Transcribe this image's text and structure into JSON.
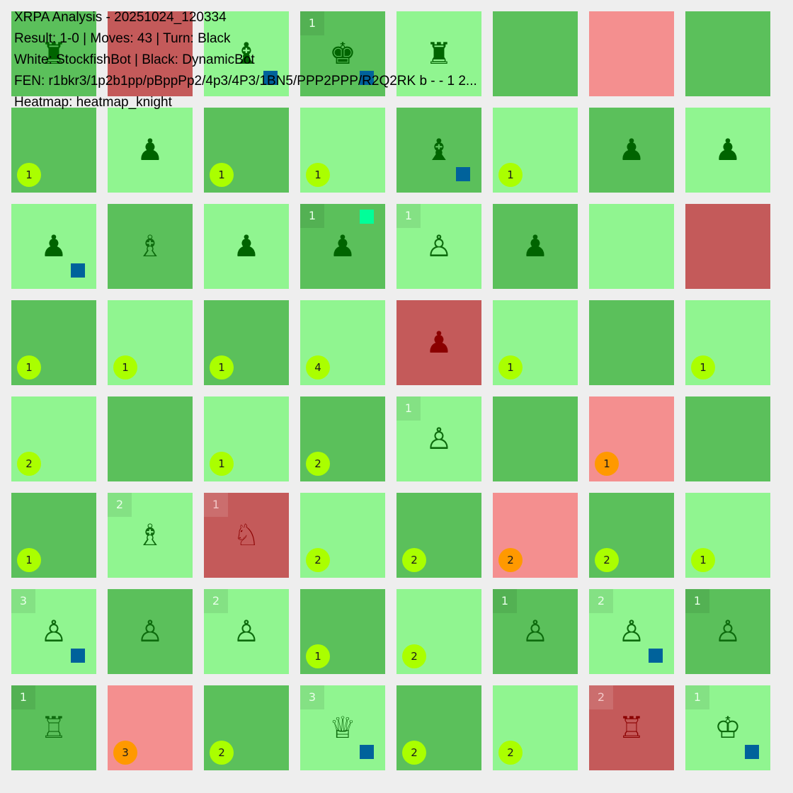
{
  "info": {
    "title": "XRPA Analysis - 20251024_120334",
    "result_line": "Result: 1-0 | Moves: 43 | Turn: Black",
    "players_line": "White: StockfishBot | Black: DynamicBot",
    "fen_line": "FEN: r1bkr3/1p2b1pp/pBppPp2/4p3/4P3/1BN5/PPP2PPP/R2Q2RK b - - 1 2...",
    "heatmap_line": "Heatmap: heatmap_knight"
  },
  "colors": {
    "light": "#90f590",
    "dark": "#5bc05b",
    "pink": "#f48f8f",
    "red": "#c45a5a",
    "white_piece": "#0d6b0d",
    "black_piece": "#006400",
    "knight_piece": "#8b0000",
    "red_piece": "#8b0000",
    "bubble_green": "#aaff00",
    "bubble_orange": "#ff9900",
    "mark_blue": "#00629b",
    "mark_cyan": "#00ff99"
  },
  "board": [
    [
      {
        "bg": "dark",
        "piece": "♜",
        "pc": "black"
      },
      {
        "bg": "red"
      },
      {
        "bg": "light",
        "piece": "♝",
        "pc": "black"
      },
      {
        "bg": "dark",
        "piece": "♚",
        "pc": "black",
        "corner": "1",
        "mark": "blue",
        "mark_pos": "tl"
      },
      {
        "bg": "light",
        "piece": "♜",
        "pc": "black",
        "mark": "blue",
        "mark_pos": "tl"
      },
      {
        "bg": "dark"
      },
      {
        "bg": "pink"
      },
      {
        "bg": "dark"
      }
    ],
    [
      {
        "bg": "dark",
        "bubble": "1",
        "bc": "green"
      },
      {
        "bg": "light",
        "piece": "♟",
        "pc": "black"
      },
      {
        "bg": "dark",
        "bubble": "1",
        "bc": "green"
      },
      {
        "bg": "light",
        "bubble": "1",
        "bc": "green"
      },
      {
        "bg": "dark",
        "piece": "♝",
        "pc": "black",
        "mark": "blue",
        "mark_pos": "br"
      },
      {
        "bg": "light",
        "bubble": "1",
        "bc": "green"
      },
      {
        "bg": "dark",
        "piece": "♟",
        "pc": "black"
      },
      {
        "bg": "light",
        "piece": "♟",
        "pc": "black"
      }
    ],
    [
      {
        "bg": "light",
        "piece": "♟",
        "pc": "black",
        "mark": "blue",
        "mark_pos": "br"
      },
      {
        "bg": "dark",
        "piece": "♗",
        "pc": "white"
      },
      {
        "bg": "light",
        "piece": "♟",
        "pc": "black"
      },
      {
        "bg": "dark",
        "piece": "♟",
        "pc": "black",
        "corner": "1",
        "mark": "cyan",
        "mark_pos": "tr"
      },
      {
        "bg": "light",
        "piece": "♙",
        "pc": "white",
        "corner": "1"
      },
      {
        "bg": "dark",
        "piece": "♟",
        "pc": "black"
      },
      {
        "bg": "light"
      },
      {
        "bg": "red"
      }
    ],
    [
      {
        "bg": "dark",
        "bubble": "1",
        "bc": "green"
      },
      {
        "bg": "light",
        "bubble": "1",
        "bc": "green"
      },
      {
        "bg": "dark",
        "bubble": "1",
        "bc": "green"
      },
      {
        "bg": "light",
        "bubble": "4",
        "bc": "green"
      },
      {
        "bg": "red",
        "piece": "♟",
        "pc": "red"
      },
      {
        "bg": "light",
        "bubble": "1",
        "bc": "green"
      },
      {
        "bg": "dark"
      },
      {
        "bg": "light",
        "bubble": "1",
        "bc": "green"
      }
    ],
    [
      {
        "bg": "light",
        "bubble": "2",
        "bc": "green"
      },
      {
        "bg": "dark"
      },
      {
        "bg": "light",
        "bubble": "1",
        "bc": "green"
      },
      {
        "bg": "dark",
        "bubble": "2",
        "bc": "green"
      },
      {
        "bg": "light",
        "piece": "♙",
        "pc": "white",
        "corner": "1"
      },
      {
        "bg": "dark"
      },
      {
        "bg": "pink",
        "bubble": "1",
        "bc": "orange"
      },
      {
        "bg": "dark"
      }
    ],
    [
      {
        "bg": "dark",
        "bubble": "1",
        "bc": "green"
      },
      {
        "bg": "light",
        "piece": "♗",
        "pc": "white",
        "corner": "2"
      },
      {
        "bg": "red",
        "piece": "♘",
        "pc": "knight",
        "corner": "1"
      },
      {
        "bg": "light",
        "bubble": "2",
        "bc": "green"
      },
      {
        "bg": "dark",
        "bubble": "2",
        "bc": "green"
      },
      {
        "bg": "pink",
        "bubble": "2",
        "bc": "orange"
      },
      {
        "bg": "dark",
        "bubble": "2",
        "bc": "green"
      },
      {
        "bg": "light",
        "bubble": "1",
        "bc": "green"
      }
    ],
    [
      {
        "bg": "light",
        "piece": "♙",
        "pc": "white",
        "corner": "3",
        "mark": "blue",
        "mark_pos": "br"
      },
      {
        "bg": "dark",
        "piece": "♙",
        "pc": "white"
      },
      {
        "bg": "light",
        "piece": "♙",
        "pc": "white",
        "corner": "2"
      },
      {
        "bg": "dark",
        "bubble": "1",
        "bc": "green"
      },
      {
        "bg": "light",
        "bubble": "2",
        "bc": "green"
      },
      {
        "bg": "dark",
        "piece": "♙",
        "pc": "white",
        "corner": "1"
      },
      {
        "bg": "light",
        "piece": "♙",
        "pc": "white",
        "corner": "2",
        "mark": "blue",
        "mark_pos": "br"
      },
      {
        "bg": "dark",
        "piece": "♙",
        "pc": "white",
        "corner": "1"
      }
    ],
    [
      {
        "bg": "dark",
        "piece": "♖",
        "pc": "white",
        "corner": "1"
      },
      {
        "bg": "pink",
        "bubble": "3",
        "bc": "orange"
      },
      {
        "bg": "dark",
        "bubble": "2",
        "bc": "green"
      },
      {
        "bg": "light",
        "piece": "♕",
        "pc": "white",
        "corner": "3",
        "mark": "blue",
        "mark_pos": "br"
      },
      {
        "bg": "dark",
        "bubble": "2",
        "bc": "green"
      },
      {
        "bg": "light",
        "bubble": "2",
        "bc": "green"
      },
      {
        "bg": "red",
        "piece": "♖",
        "pc": "red",
        "corner": "2"
      },
      {
        "bg": "light",
        "piece": "♔",
        "pc": "white",
        "corner": "1",
        "mark": "blue",
        "mark_pos": "br"
      }
    ]
  ]
}
